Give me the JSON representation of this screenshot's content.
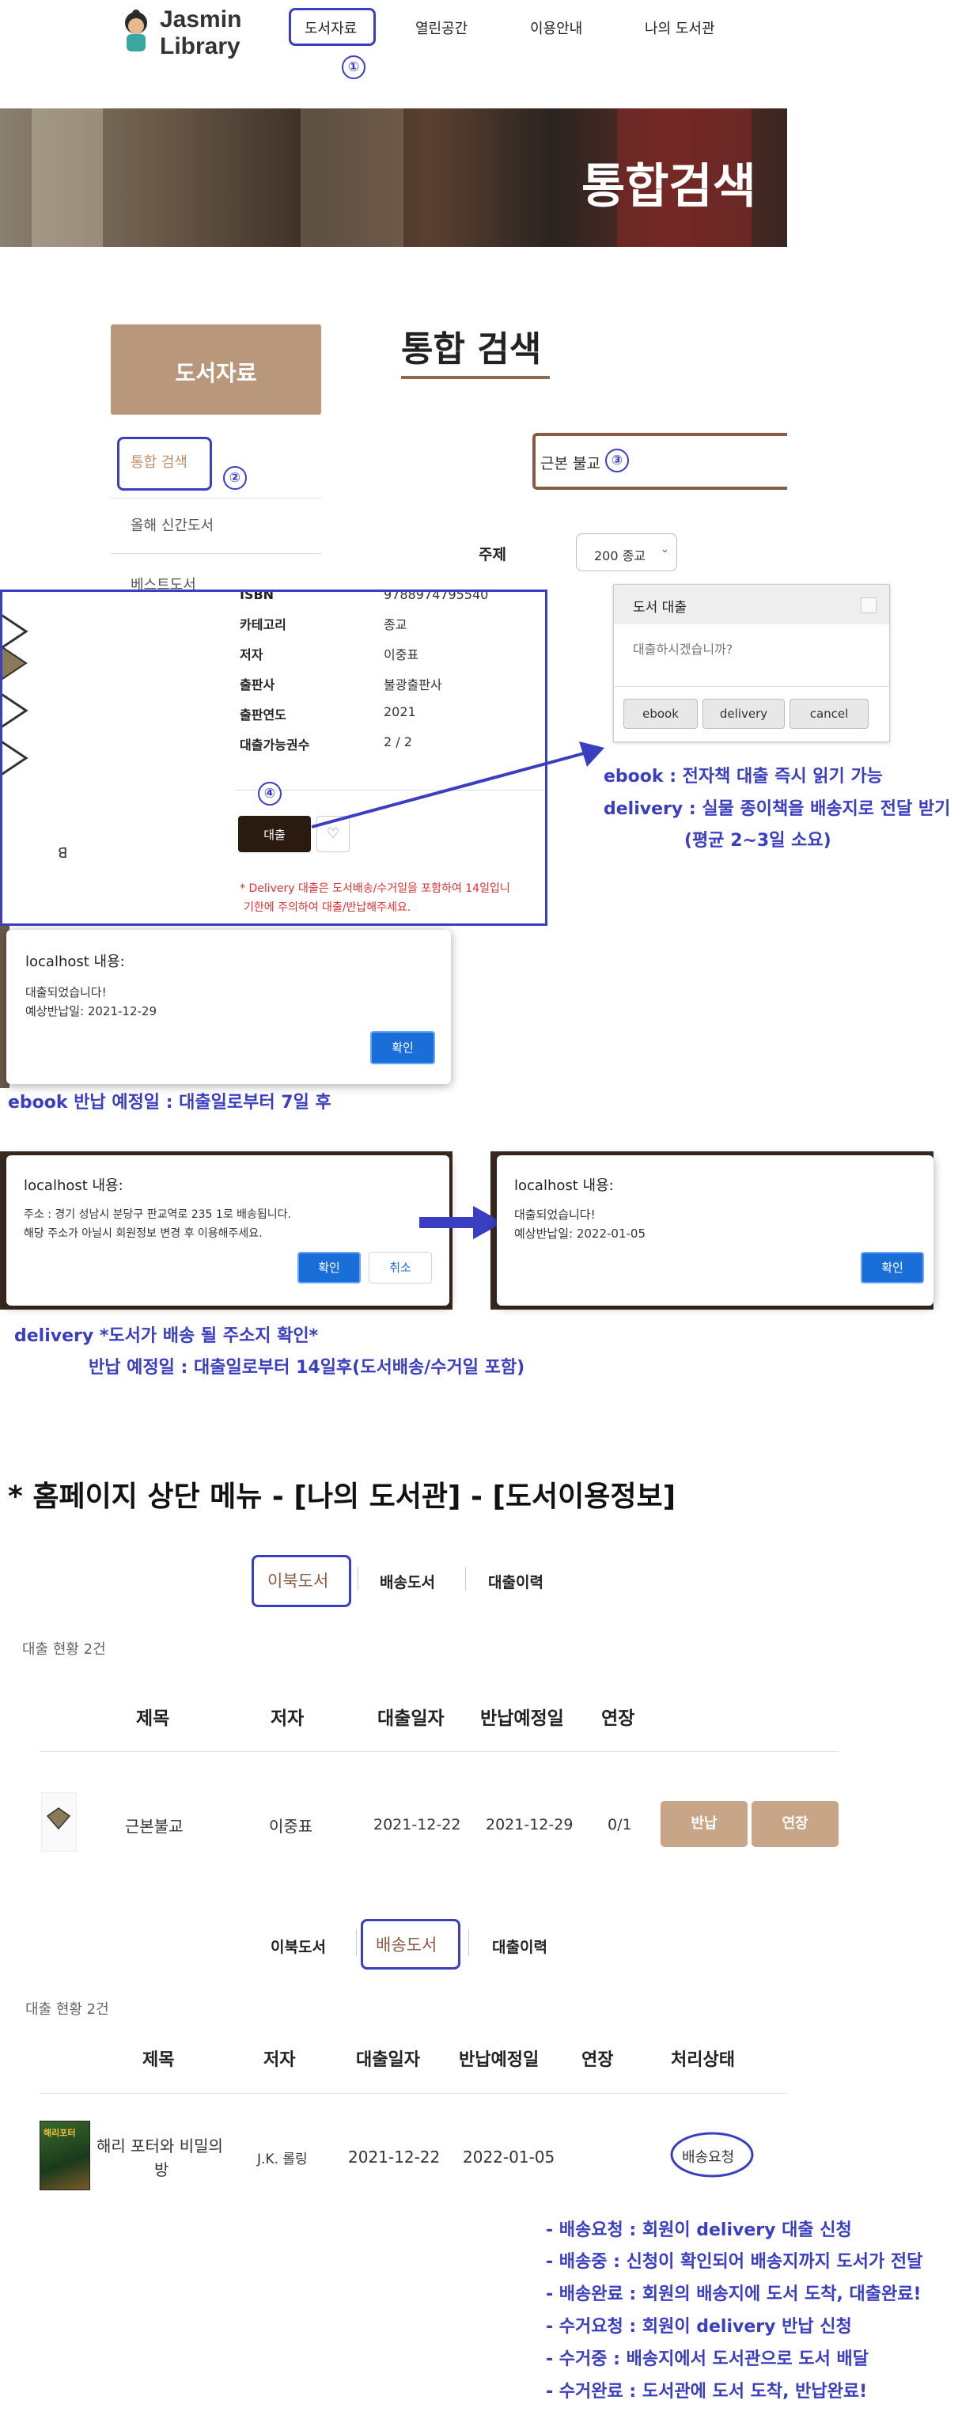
{
  "header": {
    "logo_line1": "Jasmin",
    "logo_line2": "Library",
    "nav": [
      "도서자료",
      "열린공간",
      "이용안내",
      "나의 도서관"
    ]
  },
  "banner": {
    "title": "통합검색"
  },
  "sidebar": {
    "title": "도서자료",
    "items": [
      "통합 검색",
      "올해 신간도서",
      "베스트도서"
    ]
  },
  "search": {
    "heading": "통합 검색",
    "query": "근본 불교",
    "subject_label": "주제",
    "subject_value": "200 종교"
  },
  "book": {
    "isbn_label": "ISBN",
    "isbn_value": "9788974795540",
    "fields": [
      {
        "label": "카테고리",
        "value": "종교"
      },
      {
        "label": "저자",
        "value": "이중표"
      },
      {
        "label": "출판사",
        "value": "불광출판사"
      },
      {
        "label": "출판연도",
        "value": "2021"
      },
      {
        "label": "대출가능권수",
        "value": "2 / 2"
      }
    ],
    "borrow_button": "대출",
    "notice_line1": "* Delivery 대출은 도서배송/수거일을 포함하여 14일입니",
    "notice_line2": "기한에 주의하여 대출/반납해주세요."
  },
  "loan_modal": {
    "title": "도서 대출",
    "question": "대출하시겠습니까?",
    "buttons": [
      "ebook",
      "delivery",
      "cancel"
    ]
  },
  "annotations": {
    "nums": [
      "①",
      "②",
      "③",
      "④"
    ],
    "ebook_note": "ebook : 전자책 대출 즉시 읽기 가능",
    "delivery_note": "delivery : 실물 종이책을 배송지로 전달 받기",
    "delivery_note2": "(평균 2~3일 소요)",
    "ebook_return": "ebook 반납 예정일 : 대출일로부터 7일 후",
    "delivery_addr": "delivery *도서가 배송 될 주소지 확인*",
    "delivery_return": "반납 예정일 : 대출일로부터 14일후(도서배송/수거일 포함)",
    "section_title": "* 홈페이지 상단 메뉴 - [나의 도서관] - [도서이용정보]"
  },
  "dialog1": {
    "title": "localhost 내용:",
    "line1": "대출되었습니다!",
    "line2": "예상반납일: 2021-12-29",
    "ok": "확인"
  },
  "dialog2": {
    "title": "localhost 내용:",
    "line1": "주소 : 경기 성남시 분당구 판교역로 235  1로 배송됩니다.",
    "line2": "해당 주소가 아닐시 회원정보 변경 후 이용해주세요.",
    "ok": "확인",
    "cancel": "취소"
  },
  "dialog3": {
    "title": "localhost 내용:",
    "line1": "대출되었습니다!",
    "line2": "예상반납일: 2022-01-05",
    "ok": "확인"
  },
  "mylib1": {
    "tabs": [
      "이북도서",
      "배송도서",
      "대출이력"
    ],
    "count": "대출 현황 2건",
    "headers": [
      "제목",
      "저자",
      "대출일자",
      "반납예정일",
      "연장"
    ],
    "row": {
      "title": "근본불교",
      "author": "이중표",
      "loan": "2021-12-22",
      "due": "2021-12-29",
      "ext": "0/1"
    },
    "return_btn": "반납",
    "extend_btn": "연장"
  },
  "mylib2": {
    "tabs": [
      "이북도서",
      "배송도서",
      "대출이력"
    ],
    "count": "대출 현황 2건",
    "headers": [
      "제목",
      "저자",
      "대출일자",
      "반납예정일",
      "연장",
      "처리상태"
    ],
    "row": {
      "title1": "해리 포터와 비밀의",
      "title2": "방",
      "author": "J.K. 롤링",
      "loan": "2021-12-22",
      "due": "2022-01-05",
      "status": "배송요청"
    },
    "cover_text": "해리포터"
  },
  "status_notes": [
    "- 배송요청 : 회원이 delivery 대출 신청",
    "- 배송중 : 신청이 확인되어 배송지까지 도서가 전달",
    "- 배송완료 : 회원의 배송지에 도서 도착, 대출완료!",
    "- 수거요청 : 회원이 delivery 반납 신청",
    "- 수거중 : 배송지에서 도서관으로 도서 배달",
    "- 수거완료 : 도서관에 도서 도착, 반납완료!"
  ],
  "colors": {
    "accent": "#3a3ec0",
    "brand": "#b8977a",
    "dark": "#2a1a0f",
    "notice": "#e03030"
  }
}
